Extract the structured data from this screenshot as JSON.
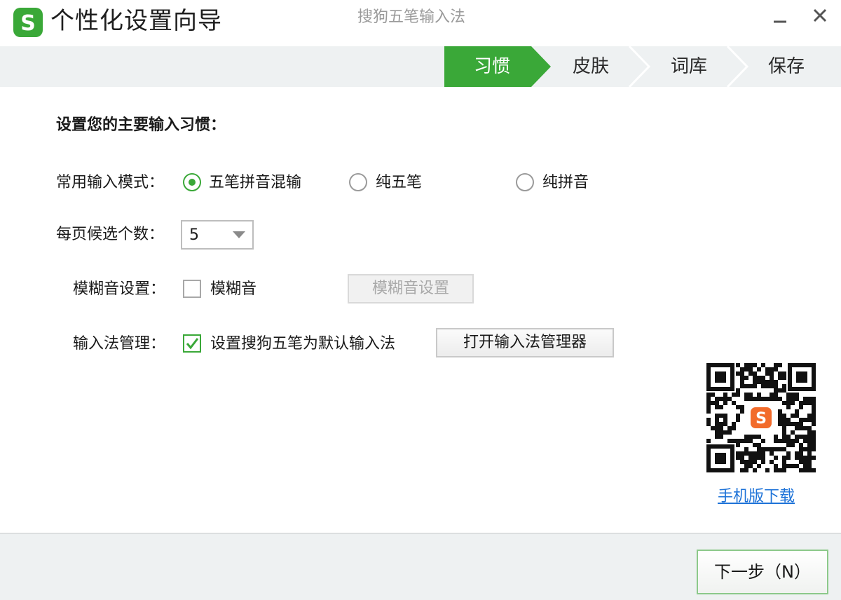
{
  "window": {
    "title": "个性化设置向导",
    "product_name": "搜狗五笔输入法",
    "logo_letter": "S",
    "accent_color": "#3aa838"
  },
  "steps": [
    {
      "label": "习惯",
      "active": true
    },
    {
      "label": "皮肤",
      "active": false
    },
    {
      "label": "词库",
      "active": false
    },
    {
      "label": "保存",
      "active": false
    }
  ],
  "content": {
    "section_title": "设置您的主要输入习惯：",
    "input_mode": {
      "label": "常用输入模式：",
      "options": [
        {
          "label": "五笔拼音混输",
          "checked": true
        },
        {
          "label": "纯五笔",
          "checked": false
        },
        {
          "label": "纯拼音",
          "checked": false
        }
      ]
    },
    "candidates": {
      "label": "每页候选个数：",
      "value": "5"
    },
    "fuzzy": {
      "label": "模糊音设置：",
      "checkbox_label": "模糊音",
      "checked": false,
      "button_label": "模糊音设置"
    },
    "ime_manage": {
      "label": "输入法管理：",
      "checkbox_label": "设置搜狗五笔为默认输入法",
      "checked": true,
      "button_label": "打开输入法管理器"
    },
    "mobile_download": "手机版下载",
    "qr_logo_letter": "S"
  },
  "footer": {
    "next_label": "下一步（N）"
  }
}
